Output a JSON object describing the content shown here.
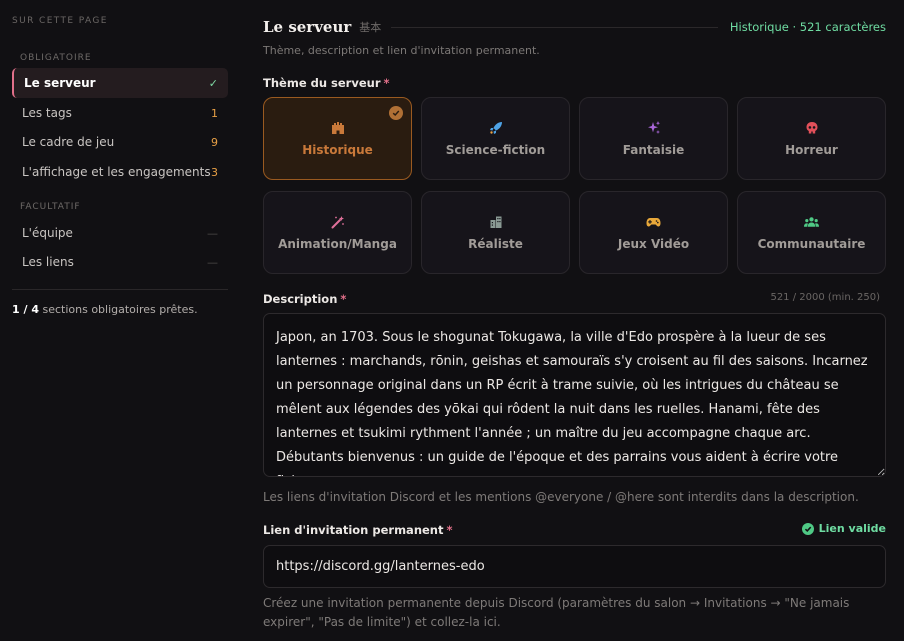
{
  "sidebar": {
    "header": "SUR CETTE PAGE",
    "required_label": "OBLIGATOIRE",
    "optional_label": "FACULTATIF",
    "required_items": [
      {
        "label": "Le serveur",
        "badge": "✓"
      },
      {
        "label": "Les tags",
        "badge": "1"
      },
      {
        "label": "Le cadre de jeu",
        "badge": "9"
      },
      {
        "label": "L'affichage et les engagements",
        "badge": "3"
      }
    ],
    "optional_items": [
      {
        "label": "L'équipe",
        "badge": "—"
      },
      {
        "label": "Les liens",
        "badge": "—"
      }
    ],
    "progress_count": "1 / 4",
    "progress_text": " sections obligatoires prêtes."
  },
  "main": {
    "title": "Le serveur",
    "title_kanji": "基本",
    "status": "Historique · 521 caractères",
    "subtitle": "Thème, description et lien d'invitation permanent.",
    "theme_label": "Thème du serveur",
    "required_mark": "*",
    "themes": [
      {
        "label": "Historique",
        "icon": "castle-icon",
        "color": "#c9793a"
      },
      {
        "label": "Science-fiction",
        "icon": "rocket-icon",
        "color": "#4ea3e6"
      },
      {
        "label": "Fantaisie",
        "icon": "sparkles-icon",
        "color": "#a866d8"
      },
      {
        "label": "Horreur",
        "icon": "skull-icon",
        "color": "#e2505a"
      },
      {
        "label": "Animation/Manga",
        "icon": "magic-wand-icon",
        "color": "#e0709a"
      },
      {
        "label": "Réaliste",
        "icon": "building-icon",
        "color": "#8a9a94"
      },
      {
        "label": "Jeux Vidéo",
        "icon": "gamepad-icon",
        "color": "#e8a83a"
      },
      {
        "label": "Communautaire",
        "icon": "users-icon",
        "color": "#4fc985"
      }
    ],
    "description_label": "Description",
    "description_counter": "521 / 2000 (min. 250)",
    "description_value": "Japon, an 1703. Sous le shogunat Tokugawa, la ville d'Edo prospère à la lueur de ses lanternes : marchands, rōnin, geishas et samouraïs s'y croisent au fil des saisons. Incarnez un personnage original dans un RP écrit à trame suivie, où les intrigues du château se mêlent aux légendes des yōkai qui rôdent la nuit dans les ruelles. Hanami, fête des lanternes et tsukimi rythment l'année ; un maître du jeu accompagne chaque arc. Débutants bienvenus : un guide de l'époque et des parrains vous aident à écrire votre fiche.",
    "description_help": "Les liens d'invitation Discord et les mentions @everyone / @here sont interdits dans la description.",
    "invite_label": "Lien d'invitation permanent",
    "invite_valid": "Lien valide",
    "invite_value": "https://discord.gg/lanternes-edo",
    "invite_help": "Créez une invitation permanente depuis Discord (paramètres du salon → Invitations → \"Ne jamais expirer\", \"Pas de limite\") et collez-la ici."
  }
}
